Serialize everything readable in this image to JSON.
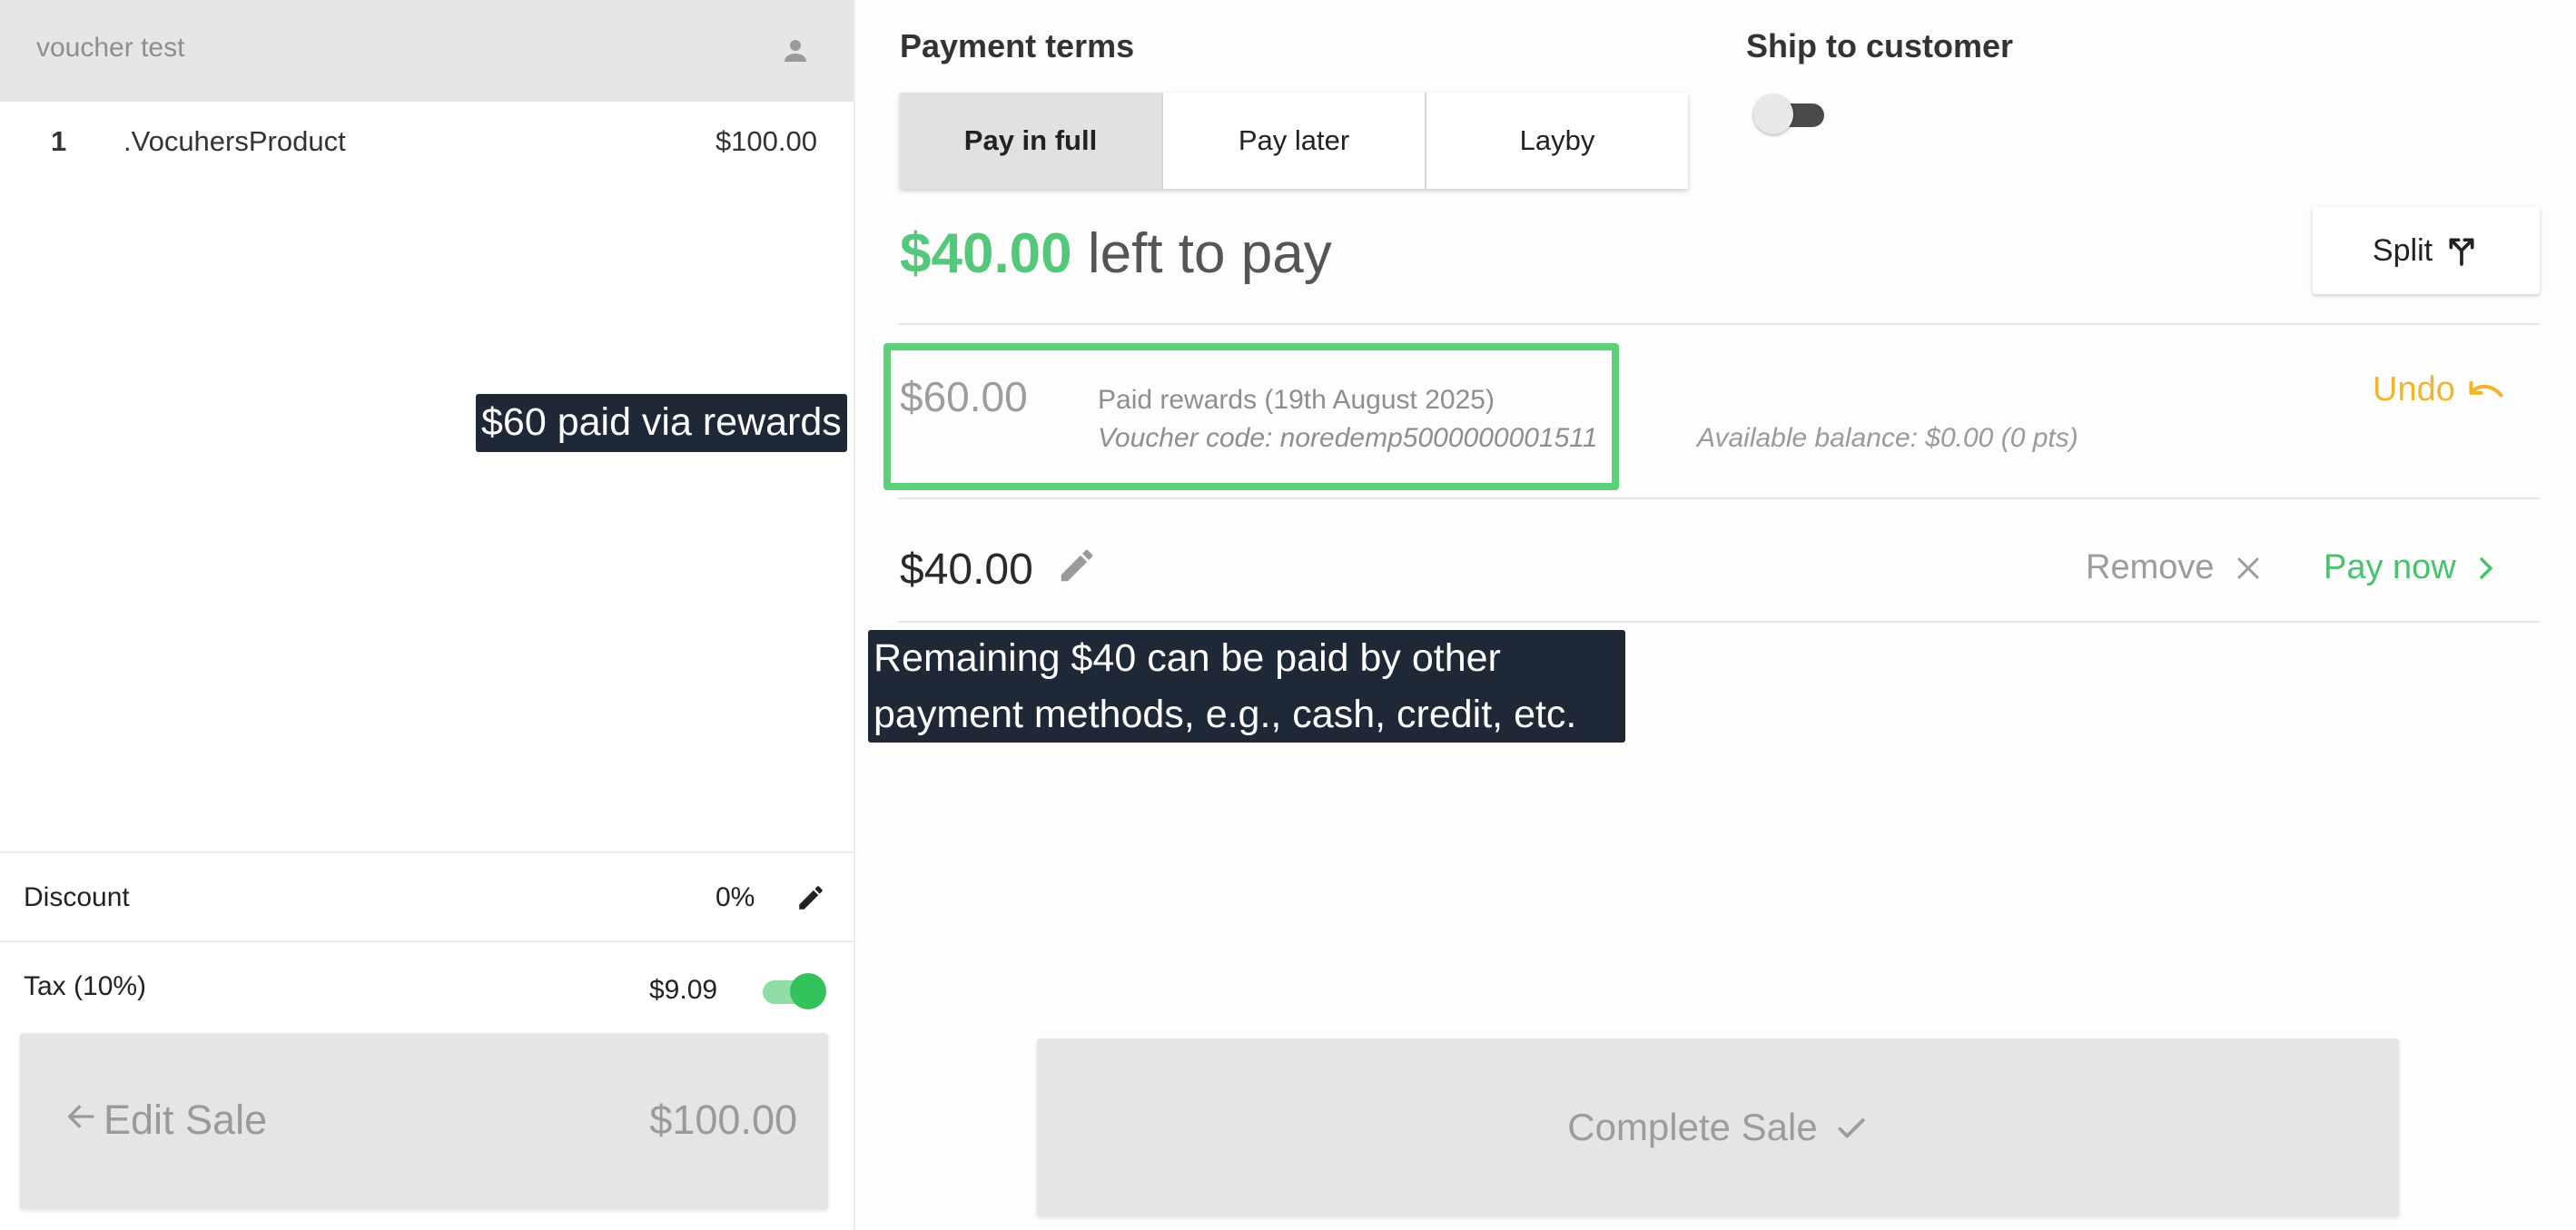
{
  "customer": {
    "name": "voucher test",
    "icon": "person-icon"
  },
  "line_items": [
    {
      "qty": "1",
      "name": ".VocuhersProduct",
      "price": "$100.00"
    }
  ],
  "summary": {
    "discount_label": "Discount",
    "discount_value": "0%",
    "tax_label": "Tax (10%)",
    "tax_value": "$9.09",
    "tax_enabled": true
  },
  "edit_sale": {
    "label": "Edit Sale",
    "total": "$100.00"
  },
  "payment_terms": {
    "title": "Payment terms",
    "options": [
      "Pay in full",
      "Pay later",
      "Layby"
    ],
    "selected": "Pay in full"
  },
  "ship_to_customer": {
    "title": "Ship to customer",
    "enabled": false
  },
  "balance": {
    "amount": "$40.00",
    "suffix": "left to pay"
  },
  "split_button": {
    "label": "Split"
  },
  "reward_payment": {
    "amount": "$60.00",
    "description": "Paid rewards (19th August 2025)",
    "voucher_code": "Voucher code: noredemp5000000001511",
    "available_balance": "Available balance: $0.00 (0 pts)",
    "undo_label": "Undo"
  },
  "pending_payment": {
    "amount": "$40.00",
    "remove_label": "Remove",
    "pay_now_label": "Pay now"
  },
  "complete_sale": {
    "label": "Complete Sale"
  },
  "annotations": {
    "rewards_note": "$60 paid via rewards",
    "remaining_note_line1": "Remaining $40 can be paid by other",
    "remaining_note_line2": "payment methods, e.g., cash, credit, etc."
  },
  "colors": {
    "accent_green": "#54c87a",
    "undo_yellow": "#efb62c",
    "highlight_green": "#5ccf79",
    "annotation_bg": "#1f2837"
  }
}
